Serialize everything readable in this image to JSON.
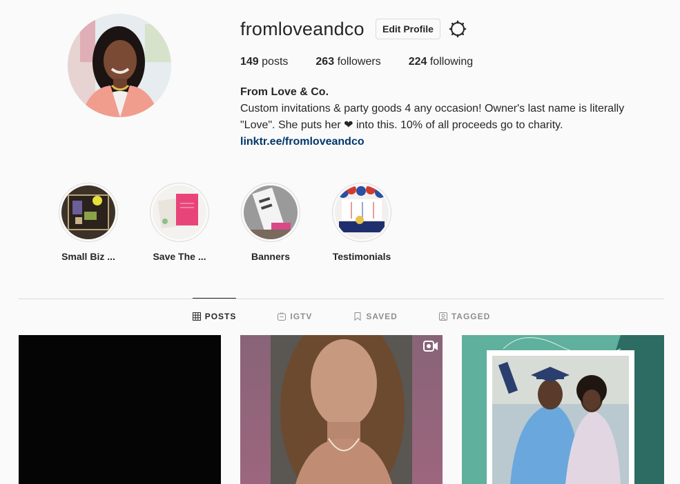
{
  "profile": {
    "username": "fromloveandco",
    "edit_label": "Edit Profile",
    "stats": {
      "posts_count": "149",
      "posts_label": "posts",
      "followers_count": "263",
      "followers_label": "followers",
      "following_count": "224",
      "following_label": "following"
    },
    "full_name": "From Love & Co.",
    "bio_line1": "Custom invitations & party goods 4 any occasion! Owner's last name is literally",
    "bio_line2": "\"Love\". She puts her ❤ into this. 10% of all proceeds go to charity.",
    "link": "linktr.ee/fromloveandco"
  },
  "highlights": [
    {
      "label": "Small Biz ..."
    },
    {
      "label": "Save The ..."
    },
    {
      "label": "Banners"
    },
    {
      "label": "Testimonials"
    }
  ],
  "tabs": [
    {
      "label": "POSTS",
      "icon": "grid-icon",
      "active": true
    },
    {
      "label": "IGTV",
      "icon": "igtv-icon",
      "active": false
    },
    {
      "label": "SAVED",
      "icon": "bookmark-icon",
      "active": false
    },
    {
      "label": "TAGGED",
      "icon": "tagged-icon",
      "active": false
    }
  ],
  "posts": [
    {
      "type": "image"
    },
    {
      "type": "video",
      "icon": "video-icon"
    },
    {
      "type": "image"
    }
  ],
  "colors": {
    "text": "#262626",
    "secondary": "#8e8e8e",
    "link": "#00376b",
    "border": "#dbdbdb",
    "background": "#fafafa"
  }
}
